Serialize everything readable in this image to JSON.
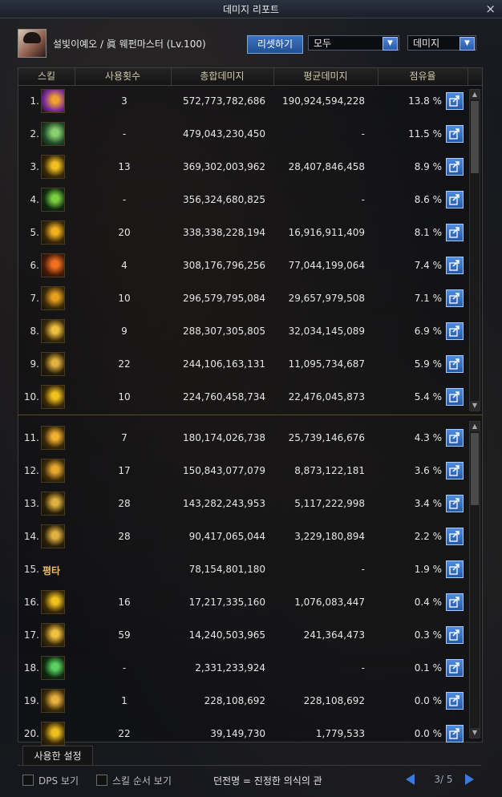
{
  "window": {
    "title": "데미지 리포트",
    "close_icon": "×"
  },
  "header": {
    "character": "설빛이예오 / 眞 웨펀마스터 (Lv.100)",
    "reset_label": "리셋하기",
    "filter_select": "모두",
    "type_select": "데미지"
  },
  "columns": [
    "스킬",
    "사용횟수",
    "총합데미지",
    "평균데미지",
    "점유율"
  ],
  "rows": [
    {
      "rank": "1.",
      "count": "3",
      "total": "572,773,782,686",
      "avg": "190,924,594,228",
      "pct": "13.8  %",
      "icon": "skill-burst-icon",
      "c1": "#7a2a9a",
      "c2": "#f0a030"
    },
    {
      "rank": "2.",
      "count": "-",
      "total": "479,043,230,450",
      "avg": "-",
      "pct": "11.5  %",
      "icon": "skill-glyph-icon",
      "c1": "#1f4a2a",
      "c2": "#8ad070"
    },
    {
      "rank": "3.",
      "count": "13",
      "total": "369,302,003,962",
      "avg": "28,407,846,458",
      "pct": "8.9  %",
      "icon": "skill-slash-ring-icon",
      "c1": "#3a2a08",
      "c2": "#f0c020"
    },
    {
      "rank": "4.",
      "count": "-",
      "total": "356,324,680,825",
      "avg": "-",
      "pct": "8.6  %",
      "icon": "skill-green-blade-icon",
      "c1": "#0f2a10",
      "c2": "#7ad040"
    },
    {
      "rank": "5.",
      "count": "20",
      "total": "338,338,228,194",
      "avg": "16,916,911,409",
      "pct": "8.1  %",
      "icon": "skill-swoosh-icon",
      "c1": "#3a2808",
      "c2": "#f0b020"
    },
    {
      "rank": "6.",
      "count": "4",
      "total": "308,176,796,256",
      "avg": "77,044,199,064",
      "pct": "7.4  %",
      "icon": "skill-spark-icon",
      "c1": "#4a1a08",
      "c2": "#f07020"
    },
    {
      "rank": "7.",
      "count": "10",
      "total": "296,579,795,084",
      "avg": "29,657,979,508",
      "pct": "7.1  %",
      "icon": "skill-sword-icon",
      "c1": "#3a2a08",
      "c2": "#e8a020"
    },
    {
      "rank": "8.",
      "count": "9",
      "total": "288,307,305,805",
      "avg": "32,034,145,089",
      "pct": "6.9  %",
      "icon": "skill-wave-icon",
      "c1": "#3a2a08",
      "c2": "#f0c040"
    },
    {
      "rank": "9.",
      "count": "22",
      "total": "244,106,163,131",
      "avg": "11,095,734,687",
      "pct": "5.9  %",
      "icon": "skill-flow-icon",
      "c1": "#2a2008",
      "c2": "#e0b040"
    },
    {
      "rank": "10.",
      "count": "10",
      "total": "224,760,458,734",
      "avg": "22,476,045,873",
      "pct": "5.4  %",
      "icon": "skill-crescent-icon",
      "c1": "#3a2a08",
      "c2": "#f0c020"
    },
    {
      "rank": "11.",
      "count": "7",
      "total": "180,174,026,738",
      "avg": "25,739,146,676",
      "pct": "4.3  %",
      "icon": "skill-flash-icon",
      "c1": "#3a2808",
      "c2": "#f0b030"
    },
    {
      "rank": "12.",
      "count": "17",
      "total": "150,843,077,079",
      "avg": "8,873,122,181",
      "pct": "3.6  %",
      "icon": "skill-dragon-icon",
      "c1": "#3a2a08",
      "c2": "#e8a830"
    },
    {
      "rank": "13.",
      "count": "28",
      "total": "143,282,243,953",
      "avg": "5,117,222,998",
      "pct": "3.4  %",
      "icon": "skill-flow-slash-icon",
      "c1": "#2a2008",
      "c2": "#e0b040"
    },
    {
      "rank": "14.",
      "count": "28",
      "total": "90,417,065,044",
      "avg": "3,229,180,894",
      "pct": "2.2  %",
      "icon": "skill-flow-wave-icon",
      "c1": "#2a2008",
      "c2": "#e0b040"
    },
    {
      "rank": "15.",
      "count": "",
      "total": "78,154,801,180",
      "avg": "-",
      "pct": "1.9  %",
      "icon_text": "평타"
    },
    {
      "rank": "16.",
      "count": "16",
      "total": "17,217,335,160",
      "avg": "1,076,083,447",
      "pct": "0.4  %",
      "icon": "skill-claw-icon",
      "c1": "#3a2a08",
      "c2": "#f0c020"
    },
    {
      "rank": "17.",
      "count": "59",
      "total": "14,240,503,965",
      "avg": "241,364,473",
      "pct": "0.3  %",
      "icon": "skill-dash-icon",
      "c1": "#3a2a08",
      "c2": "#f0c040"
    },
    {
      "rank": "18.",
      "count": "-",
      "total": "2,331,233,924",
      "avg": "-",
      "pct": "0.1  %",
      "icon": "skill-green-slash-icon",
      "c1": "#0f2a10",
      "c2": "#5ad060"
    },
    {
      "rank": "19.",
      "count": "1",
      "total": "228,108,692",
      "avg": "228,108,692",
      "pct": "0.0  %",
      "icon": "skill-rays-icon",
      "c1": "#3a2a08",
      "c2": "#e8b040"
    },
    {
      "rank": "20.",
      "count": "22",
      "total": "39,149,730",
      "avg": "1,779,533",
      "pct": "0.0  %",
      "icon": "skill-arc-icon",
      "c1": "#3a2a08",
      "c2": "#f0c020"
    }
  ],
  "tabs": {
    "settings": "사용한 설정"
  },
  "footer": {
    "dps_label": "DPS 보기",
    "order_label": "스킬 순서 보기",
    "dungeon": "던전명 = 진정한 의식의 관",
    "page": "3/ 5"
  }
}
